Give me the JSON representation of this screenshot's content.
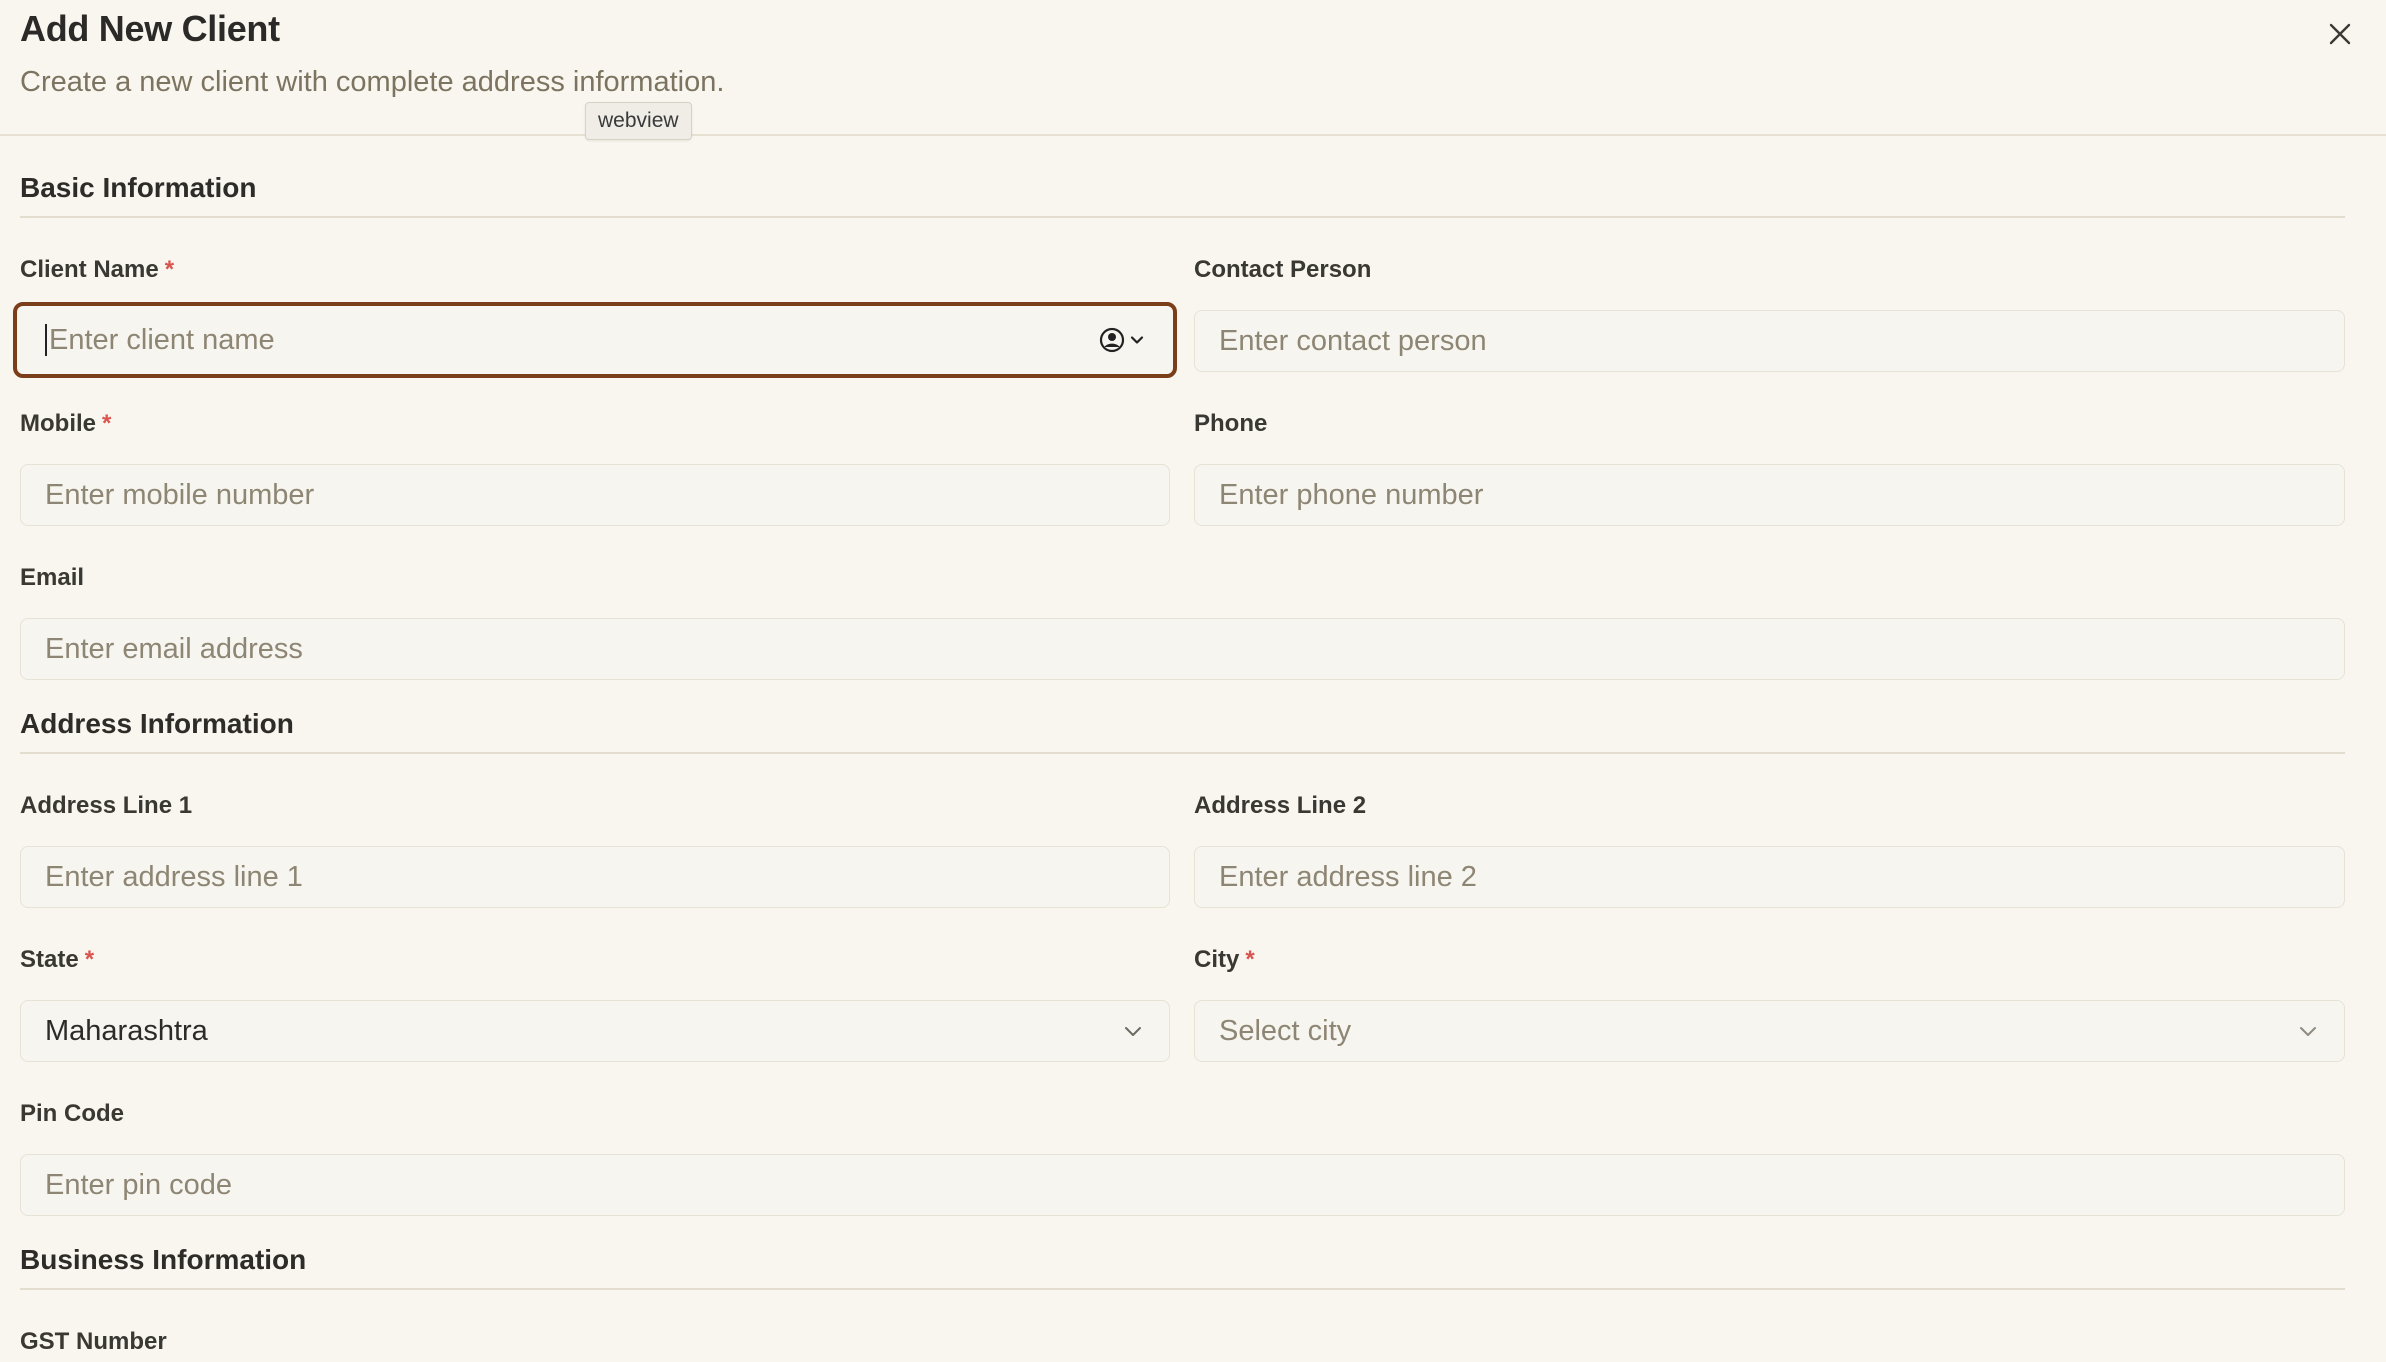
{
  "dialog": {
    "title": "Add New Client",
    "subtitle": "Create a new client with complete address information.",
    "tooltip": "webview",
    "close_icon": "close-icon"
  },
  "sections": {
    "basic": "Basic Information",
    "address": "Address Information",
    "business": "Business Information"
  },
  "fields": {
    "client_name": {
      "label": "Client Name",
      "placeholder": "Enter client name",
      "required": "*"
    },
    "contact_person": {
      "label": "Contact Person",
      "placeholder": "Enter contact person"
    },
    "mobile": {
      "label": "Mobile",
      "placeholder": "Enter mobile number",
      "required": "*"
    },
    "phone": {
      "label": "Phone",
      "placeholder": "Enter phone number"
    },
    "email": {
      "label": "Email",
      "placeholder": "Enter email address"
    },
    "address1": {
      "label": "Address Line 1",
      "placeholder": "Enter address line 1"
    },
    "address2": {
      "label": "Address Line 2",
      "placeholder": "Enter address line 2"
    },
    "state": {
      "label": "State",
      "value": "Maharashtra",
      "required": "*"
    },
    "city": {
      "label": "City",
      "placeholder": "Select city",
      "required": "*"
    },
    "pin": {
      "label": "Pin Code",
      "placeholder": "Enter pin code"
    },
    "gst": {
      "label": "GST Number"
    }
  },
  "colors": {
    "background": "#f8f6ee",
    "focus_border": "#7a3f1a",
    "required": "#d9534f"
  }
}
